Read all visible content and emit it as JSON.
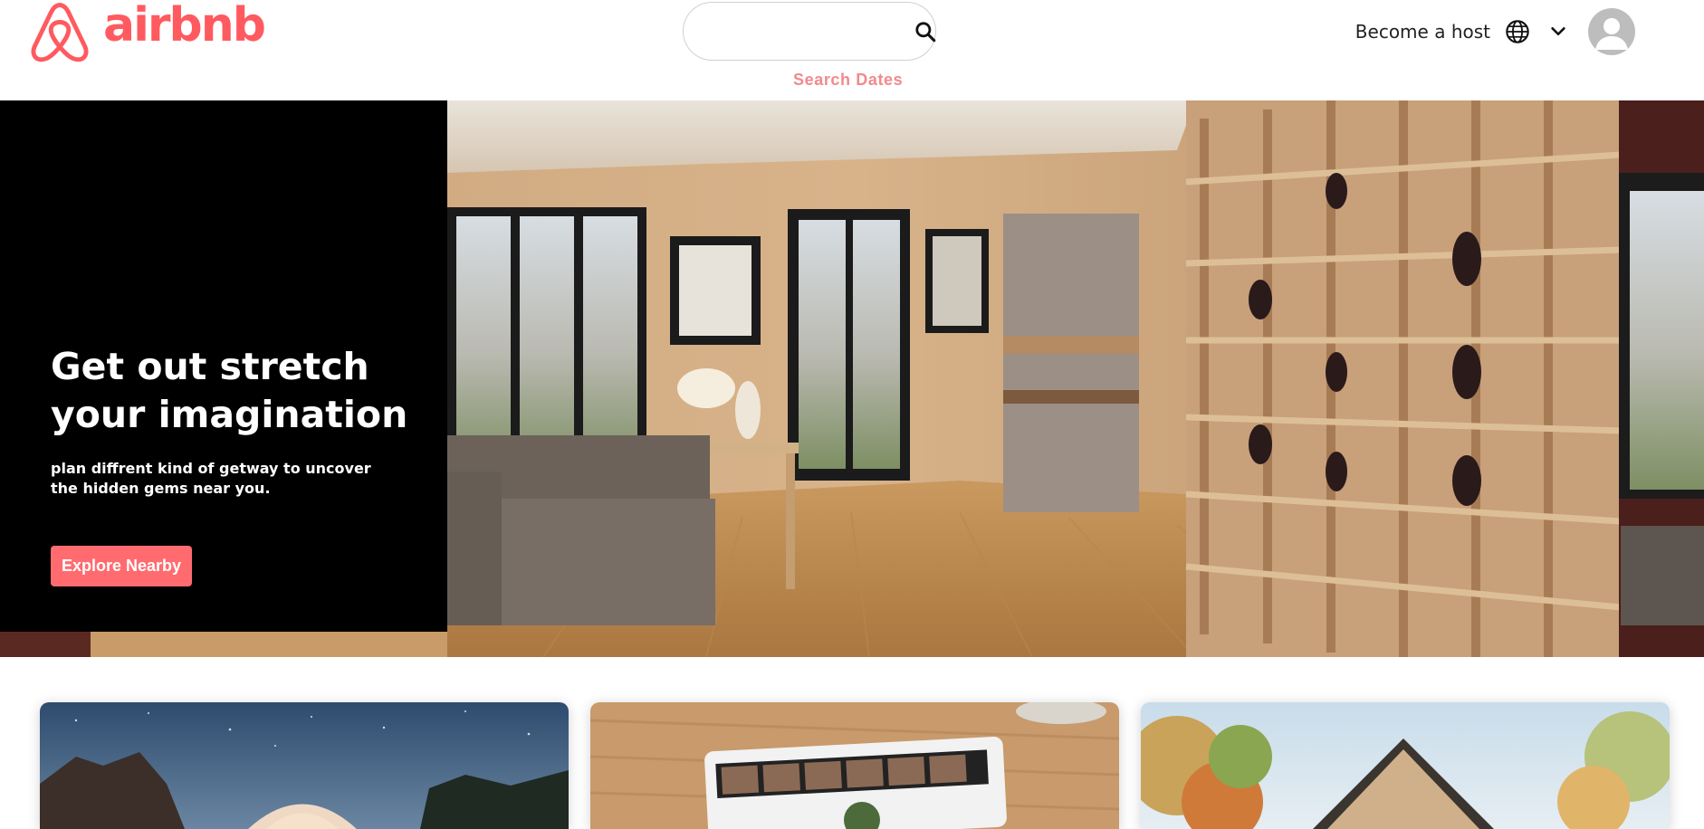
{
  "brand": {
    "name": "airbnb",
    "color": "#FF5A5F"
  },
  "header": {
    "search": {
      "placeholder": "",
      "value": "",
      "icon": "search-icon"
    },
    "search_dates_label": "Search Dates",
    "become_host_label": "Become a host",
    "language_icon": "globe-icon",
    "menu_icon": "chevron-down-icon",
    "avatar_icon": "user-avatar-icon"
  },
  "hero": {
    "title": "Get out stretch your imagination",
    "subtitle": "plan diffrent kind of getway to uncover the hidden gems near you.",
    "cta_label": "Explore Nearby",
    "cta_color": "#ff6b6f",
    "image": "living-room-interior-photo"
  },
  "cards": [
    {
      "image": "glamping-dome-night-photo"
    },
    {
      "image": "online-experience-tablet-photo"
    },
    {
      "image": "wooden-cabin-autumn-photo"
    }
  ]
}
